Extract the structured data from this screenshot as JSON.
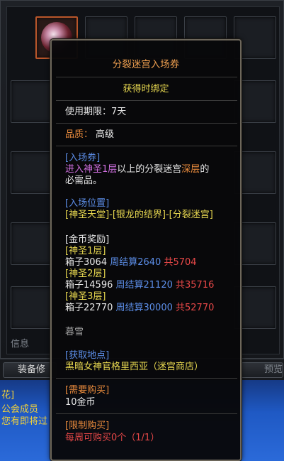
{
  "background": {
    "bottom_left_label": "信息",
    "equip_button": "装备修",
    "preview_button": "预览",
    "chat": [
      "花]",
      "公会成员",
      "您有即将过"
    ]
  },
  "tooltip": {
    "title": "分裂迷宫入场券",
    "bind": "获得时绑定",
    "duration": "使用期限：7天",
    "grade_label": "品质：",
    "grade_value": "高级",
    "ticket_header": "[入场券]",
    "desc_part1": "进入神圣1层",
    "desc_part2": "以上的分裂迷宫",
    "desc_part3": "深层",
    "desc_part4": "的",
    "desc_line2": "必需品。",
    "location_header": "[入场位置]",
    "location_value": "[神圣天堂]-[银龙的结界]-[分裂迷宫]",
    "gold_header": "[金币奖励]",
    "floors": [
      {
        "name": "[神圣1层]",
        "box": "箱子3064",
        "weekly": "周结算2640",
        "total": "共5704"
      },
      {
        "name": "[神圣2层]",
        "box": "箱子14596",
        "weekly": "周结算21120",
        "total": "共35716"
      },
      {
        "name": "[神圣3层]",
        "box": "箱子22770",
        "weekly": "周结算30000",
        "total": "共52770"
      }
    ],
    "author": "暮雪",
    "source_header": "[获取地点]",
    "source_value": "黑暗女神官格里西亚（迷宫商店）",
    "buy_header": "[需要购买]",
    "buy_value": "10金币",
    "limit_header": "[限制购买]",
    "limit_value": "每周可购买0个（1/1）"
  }
}
